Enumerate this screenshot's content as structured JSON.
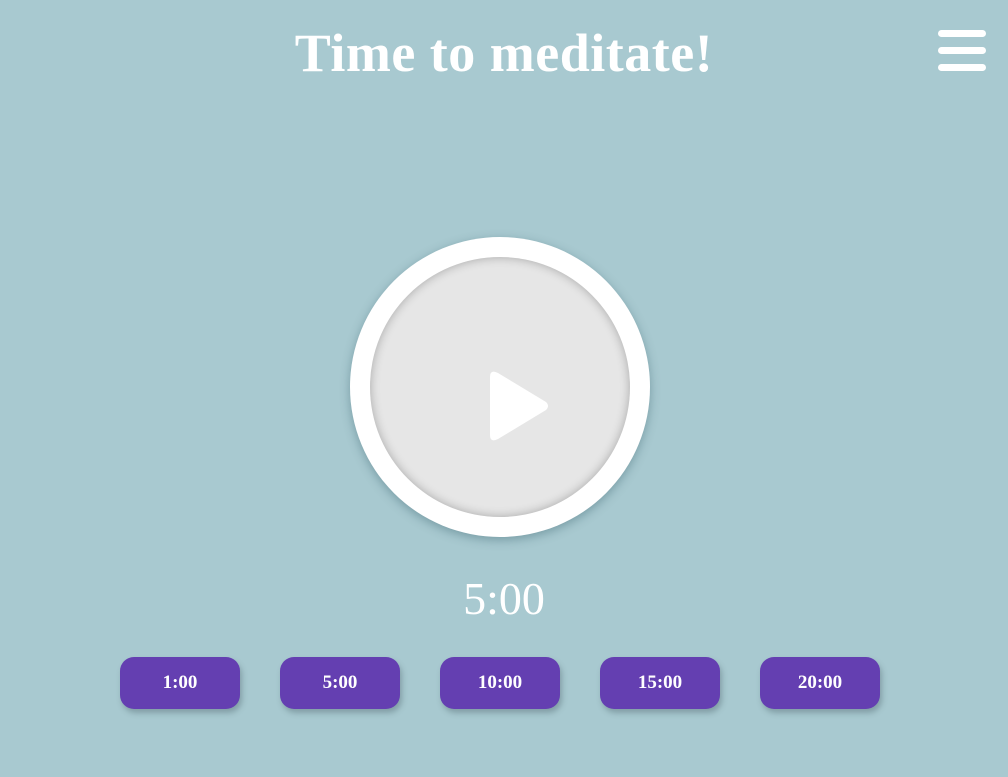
{
  "header": {
    "title": "Time to meditate!",
    "menu_icon": "hamburger-menu-icon"
  },
  "player": {
    "play_icon": "play-icon",
    "timer_display": "5:00"
  },
  "presets": [
    {
      "label": "1:00"
    },
    {
      "label": "5:00"
    },
    {
      "label": "10:00"
    },
    {
      "label": "15:00"
    },
    {
      "label": "20:00"
    }
  ],
  "colors": {
    "background": "#a8c9d0",
    "button": "#643fb1",
    "text": "#ffffff",
    "play_inner": "#e6e6e6"
  }
}
